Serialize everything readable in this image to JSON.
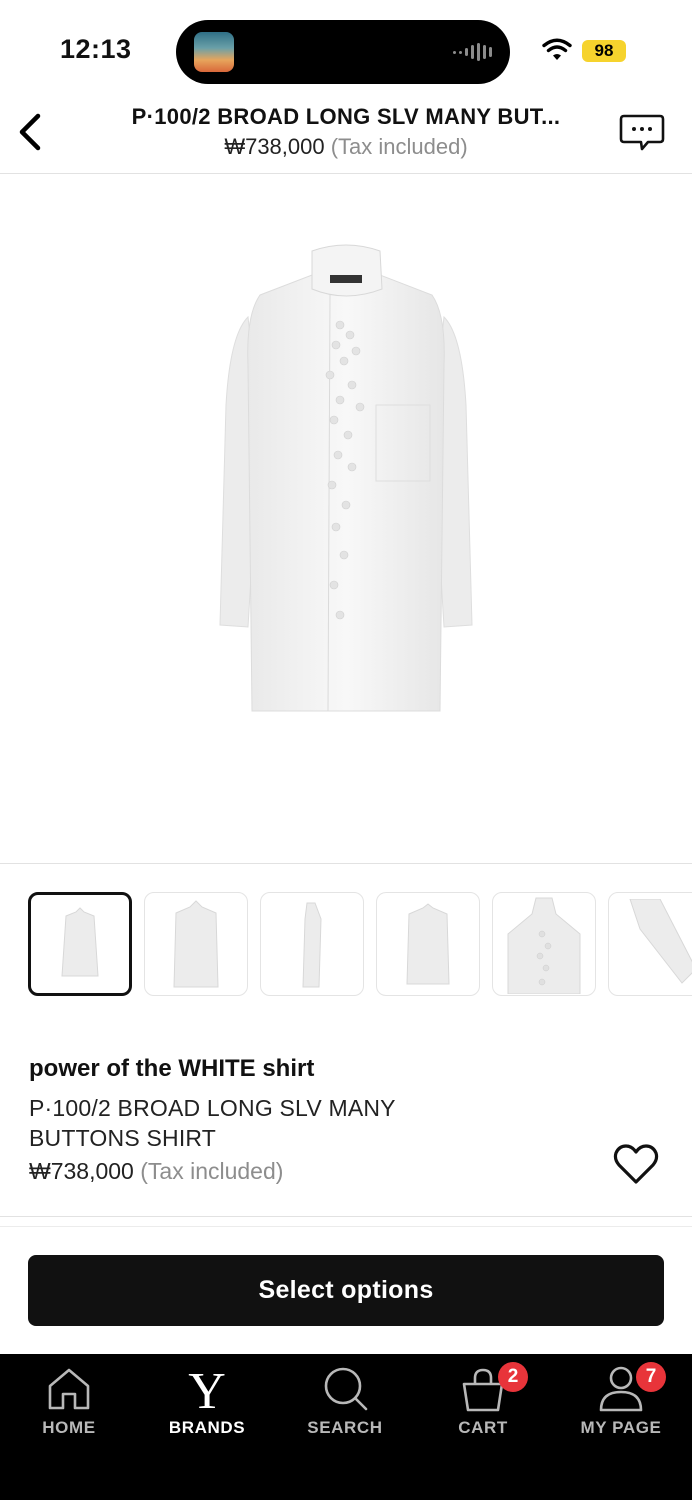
{
  "status_bar": {
    "time": "12:13",
    "battery": "98",
    "battery_color": "#f6d32d"
  },
  "header": {
    "title": "P·100/2 BROAD LONG SLV MANY BUT...",
    "price": "₩738,000",
    "tax_note": "(Tax included)"
  },
  "gallery": {
    "thumbnails": [
      {
        "view": "front"
      },
      {
        "view": "front-close"
      },
      {
        "view": "side"
      },
      {
        "view": "back"
      },
      {
        "view": "collar-detail"
      },
      {
        "view": "sleeve-detail"
      }
    ],
    "selected_index": 0
  },
  "product": {
    "collection": "power of the WHITE shirt",
    "name": "P·100/2 BROAD LONG SLV MANY BUTTONS SHIRT",
    "price": "₩738,000",
    "tax_note": "(Tax included)",
    "favorite_icon": "heart-outline-icon"
  },
  "cta": {
    "label": "Select options"
  },
  "tabbar": {
    "items": [
      {
        "label": "HOME",
        "icon": "home-icon"
      },
      {
        "label": "BRANDS",
        "icon": "brand-y-icon"
      },
      {
        "label": "SEARCH",
        "icon": "search-icon"
      },
      {
        "label": "CART",
        "icon": "cart-icon",
        "badge": "2"
      },
      {
        "label": "MY PAGE",
        "icon": "user-icon",
        "badge": "7"
      }
    ],
    "active": "BRANDS",
    "badge_color": "#e8343a"
  }
}
